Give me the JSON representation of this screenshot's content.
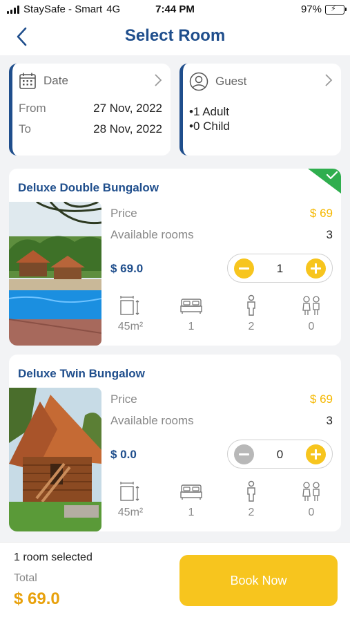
{
  "status": {
    "carrier": "StaySafe - Smart",
    "network": "4G",
    "time": "7:44 PM",
    "battery": "97%",
    "battery_level": 0.97
  },
  "header": {
    "title": "Select Room",
    "back_icon": "chevron-left-icon"
  },
  "date_card": {
    "title": "Date",
    "icon": "calendar-icon",
    "from_label": "From",
    "from_value": "27 Nov, 2022",
    "to_label": "To",
    "to_value": "28 Nov, 2022"
  },
  "guest_card": {
    "title": "Guest",
    "icon": "user-icon",
    "adults": "•1 Adult",
    "children": "•0 Child"
  },
  "rooms": [
    {
      "name": "Deluxe Double Bungalow",
      "selected": true,
      "price_label": "Price",
      "price": "$ 69",
      "available_label": "Available rooms",
      "available": "3",
      "line_total": "$ 69.0",
      "quantity": "1",
      "amenities": {
        "area": "45m²",
        "beds": "1",
        "adults": "2",
        "children": "0"
      }
    },
    {
      "name": "Deluxe Twin Bungalow",
      "selected": false,
      "price_label": "Price",
      "price": "$ 69",
      "available_label": "Available rooms",
      "available": "3",
      "line_total": "$ 0.0",
      "quantity": "0",
      "amenities": {
        "area": "45m²",
        "beds": "1",
        "adults": "2",
        "children": "0"
      }
    }
  ],
  "footer": {
    "selected_text": "1 room selected",
    "total_label": "Total",
    "total_value": "$ 69.0",
    "book_label": "Book Now"
  },
  "colors": {
    "primary": "#1f4e8c",
    "accent": "#f7c51e",
    "selected_badge": "#2fae4e",
    "total": "#e8a10c"
  }
}
